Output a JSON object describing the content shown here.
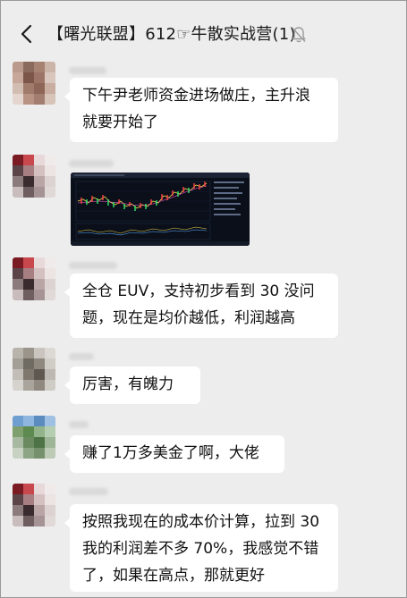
{
  "header": {
    "title": "【曙光联盟】612☞牛散实战营(1)"
  },
  "messages": [
    {
      "type": "text",
      "lines": [
        "下午尹老师资金进场做庄，主升浪",
        "就要开始了"
      ]
    },
    {
      "type": "image",
      "content": "stock-chart-screenshot"
    },
    {
      "type": "text",
      "lines": [
        "全仓 EUV，支持初步看到 30 没问",
        "题，现在是均价越低，利润越高"
      ]
    },
    {
      "type": "text",
      "lines": [
        "厉害，有魄力"
      ]
    },
    {
      "type": "text",
      "lines": [
        "赚了1万多美金了啊，大佬"
      ]
    },
    {
      "type": "text",
      "lines": [
        "按照我现在的成本价计算，拉到 30",
        "我的利润差不多 70%，我感觉不错",
        "了，如果在高点，那就更好"
      ]
    }
  ],
  "colors": {
    "background": "#ededed",
    "bubble": "#ffffff",
    "text": "#111111"
  }
}
